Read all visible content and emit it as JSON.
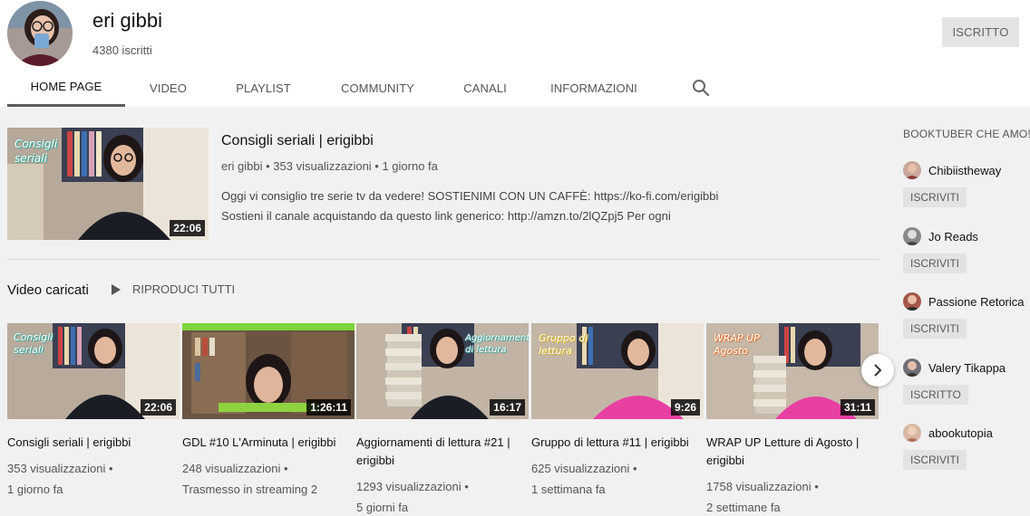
{
  "channel": {
    "name": "eri gibbi",
    "subscribers": "4380 iscritti",
    "subscribe_label": "ISCRITTO"
  },
  "tabs": [
    {
      "label": "HOME PAGE",
      "active": true
    },
    {
      "label": "VIDEO"
    },
    {
      "label": "PLAYLIST"
    },
    {
      "label": "COMMUNITY"
    },
    {
      "label": "CANALI"
    },
    {
      "label": "INFORMAZIONI"
    }
  ],
  "featured": {
    "title": "Consigli seriali | erigibbi",
    "meta": "eri gibbi • 353 visualizzazioni • 1 giorno fa",
    "desc_line1": "Oggi vi consiglio tre serie tv da vedere! SOSTIENIMI CON UN CAFFÈ: https://ko-fi.com/erigibbi",
    "desc_line2": "Sostieni il canale acquistando da questo link generico: http://amzn.to/2lQZpj5 Per ogni",
    "duration": "22:06",
    "thumb_text": "Consigli seriali"
  },
  "uploads": {
    "title": "Video caricati",
    "play_all": "RIPRODUCI TUTTI",
    "videos": [
      {
        "title": "Consigli seriali | erigibbi",
        "views": "353 visualizzazioni •",
        "age": "1 giorno fa",
        "duration": "22:06",
        "thumb_text": "Consigli seriali"
      },
      {
        "title": "GDL #10 L'Arminuta | erigibbi",
        "views": "248 visualizzazioni •",
        "age": "Trasmesso in streaming 2",
        "duration": "1:26:11",
        "thumb_text": ""
      },
      {
        "title": "Aggiornamenti di lettura #21 | erigibbi",
        "views": "1293 visualizzazioni •",
        "age": "5 giorni fa",
        "duration": "16:17",
        "thumb_text": "Aggiornamenti di lettura"
      },
      {
        "title": "Gruppo di lettura #11 | erigibbi",
        "views": "625 visualizzazioni •",
        "age": "1 settimana fa",
        "duration": "9:26",
        "thumb_text": "Gruppo di lettura"
      },
      {
        "title": "WRAP UP Letture di Agosto | erigibbi",
        "views": "1758 visualizzazioni •",
        "age": "2 settimane fa",
        "duration": "31:11",
        "thumb_text": "WRAP UP Agosto"
      }
    ]
  },
  "sidebar": {
    "title": "BOOKTUBER CHE AMO!",
    "channels": [
      {
        "name": "Chibiistheway",
        "button": "ISCRIVITI"
      },
      {
        "name": "Jo Reads",
        "button": "ISCRIVITI"
      },
      {
        "name": "Passione Retorica",
        "button": "ISCRIVITI"
      },
      {
        "name": "Valery Tikappa",
        "button": "ISCRITTO"
      },
      {
        "name": "abookutopia",
        "button": "ISCRIVITI"
      }
    ]
  },
  "colors": {
    "background": "#f1f1f1",
    "header": "#ffffff",
    "active_tab_underline": "#5b5b5b",
    "button_grey": "#e4e4e4"
  }
}
